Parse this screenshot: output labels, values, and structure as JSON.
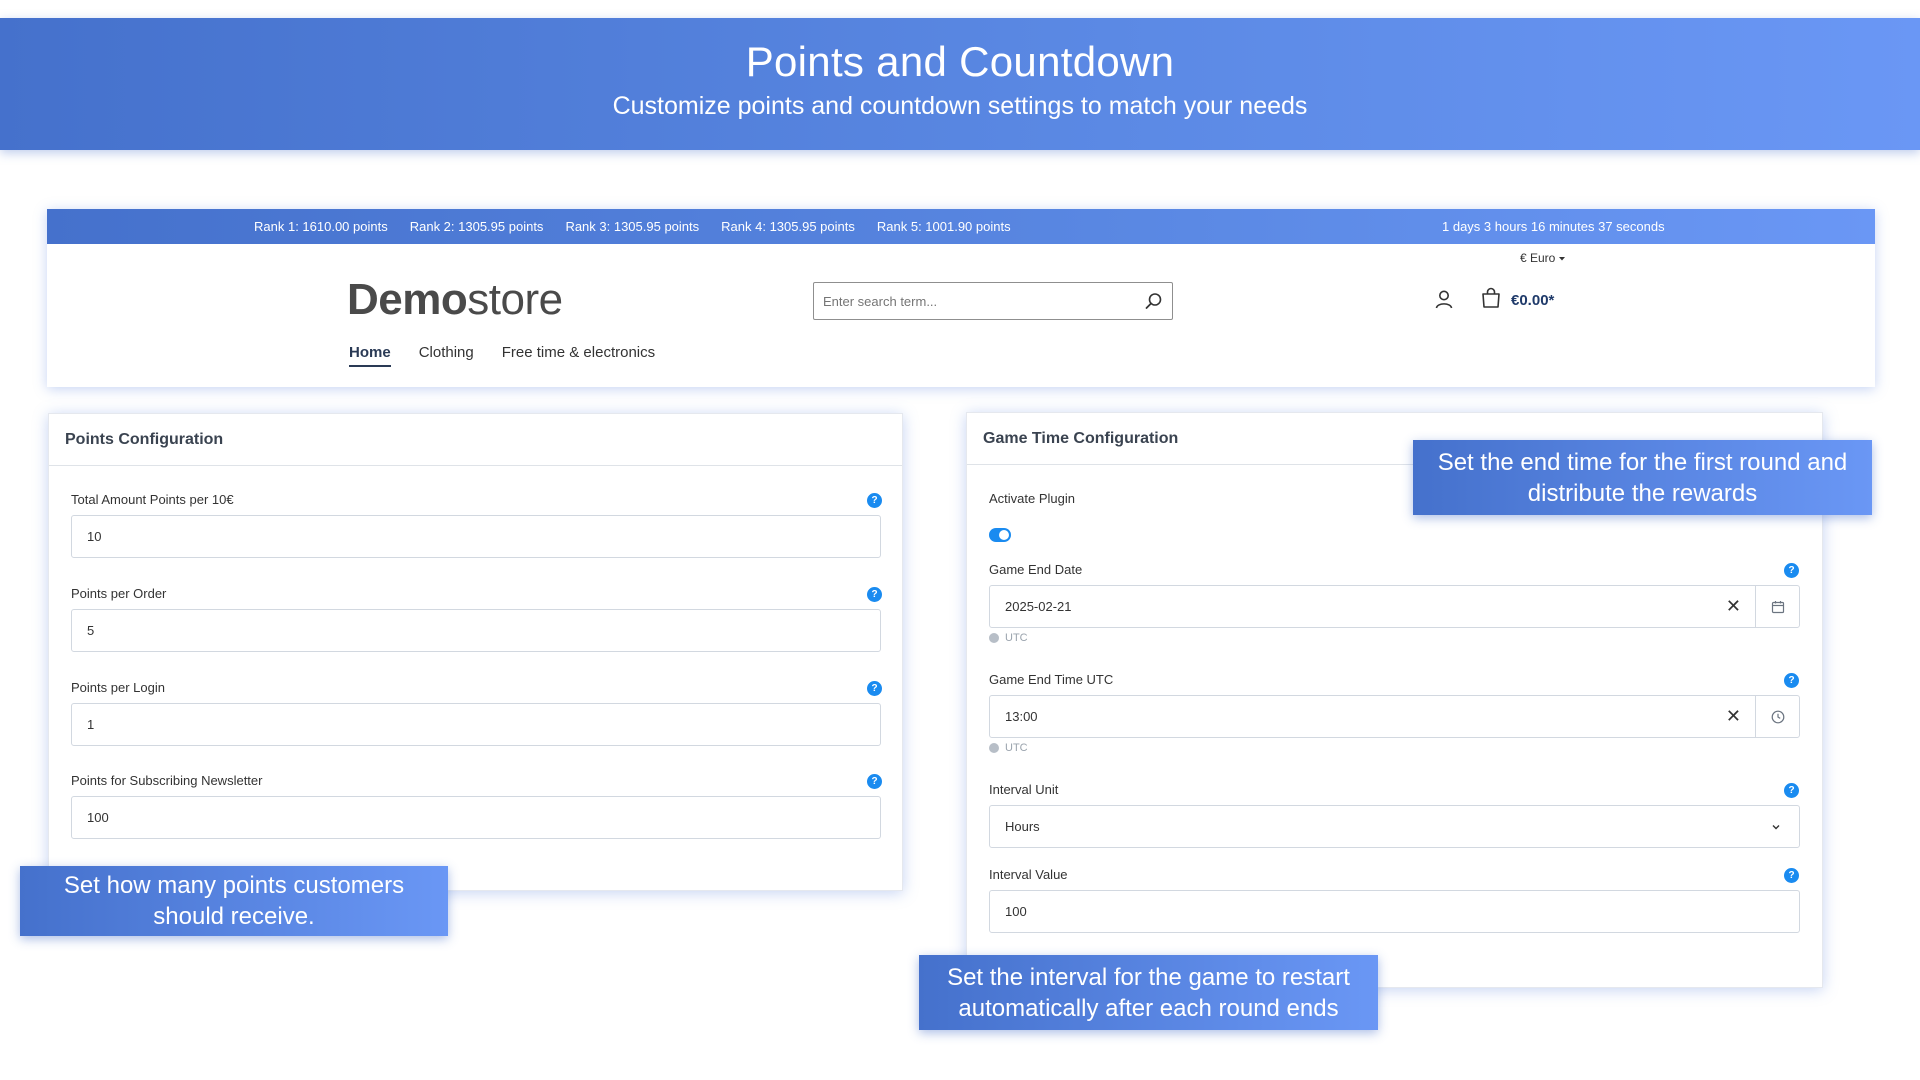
{
  "hero": {
    "title": "Points and Countdown",
    "subtitle": "Customize points and countdown settings to match your needs"
  },
  "store": {
    "ranks": [
      "Rank 1: 1610.00 points",
      "Rank 2: 1305.95 points",
      "Rank 3: 1305.95 points",
      "Rank 4: 1305.95 points",
      "Rank 5: 1001.90 points"
    ],
    "countdown": "1 days 3 hours 16 minutes 37 seconds",
    "currency": "€ Euro",
    "logo_bold": "Demo",
    "logo_light": "store",
    "search_placeholder": "Enter search term...",
    "cart_amount": "€0.00*",
    "nav": [
      "Home",
      "Clothing",
      "Free time & electronics"
    ]
  },
  "points_card": {
    "title": "Points Configuration",
    "fields": [
      {
        "label": "Total Amount Points per 10€",
        "value": "10"
      },
      {
        "label": "Points per Order",
        "value": "5"
      },
      {
        "label": "Points per Login",
        "value": "1"
      },
      {
        "label": "Points for Subscribing Newsletter",
        "value": "100"
      }
    ]
  },
  "game_card": {
    "title": "Game Time Configuration",
    "activate_label": "Activate Plugin",
    "activate_on": true,
    "end_date_label": "Game End Date",
    "end_date_value": "2025-02-21",
    "end_time_label": "Game End Time UTC",
    "end_time_value": "13:00",
    "utc_hint": "UTC",
    "interval_unit_label": "Interval Unit",
    "interval_unit_value": "Hours",
    "interval_value_label": "Interval Value",
    "interval_value": "100"
  },
  "callouts": {
    "end_time": "Set the end time for the first round and distribute the rewards",
    "points": "Set how many points customers should receive.",
    "interval": "Set the interval for the game to restart automatically after each round ends"
  },
  "colors": {
    "banner_start": "#4571cc",
    "banner_end": "#6a97f5",
    "help_icon": "#1a8bf0",
    "toggle_on": "#1a8bf0"
  }
}
